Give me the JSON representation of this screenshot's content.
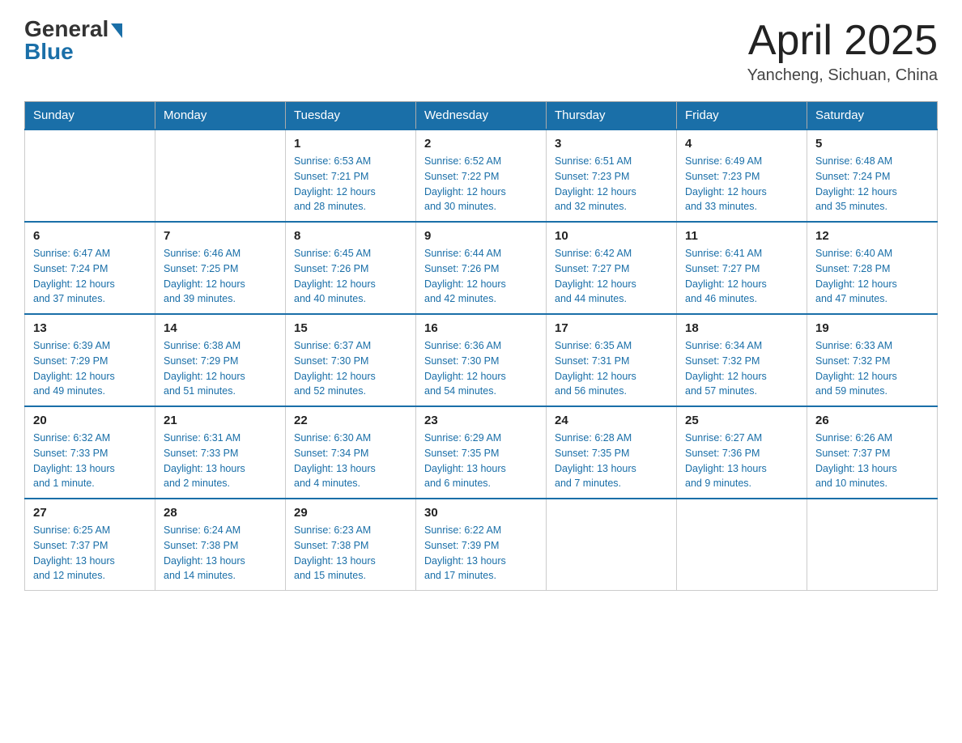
{
  "header": {
    "logo_general": "General",
    "logo_blue": "Blue",
    "title": "April 2025",
    "location": "Yancheng, Sichuan, China"
  },
  "days_of_week": [
    "Sunday",
    "Monday",
    "Tuesday",
    "Wednesday",
    "Thursday",
    "Friday",
    "Saturday"
  ],
  "weeks": [
    [
      {
        "day": "",
        "info": ""
      },
      {
        "day": "",
        "info": ""
      },
      {
        "day": "1",
        "info": "Sunrise: 6:53 AM\nSunset: 7:21 PM\nDaylight: 12 hours\nand 28 minutes."
      },
      {
        "day": "2",
        "info": "Sunrise: 6:52 AM\nSunset: 7:22 PM\nDaylight: 12 hours\nand 30 minutes."
      },
      {
        "day": "3",
        "info": "Sunrise: 6:51 AM\nSunset: 7:23 PM\nDaylight: 12 hours\nand 32 minutes."
      },
      {
        "day": "4",
        "info": "Sunrise: 6:49 AM\nSunset: 7:23 PM\nDaylight: 12 hours\nand 33 minutes."
      },
      {
        "day": "5",
        "info": "Sunrise: 6:48 AM\nSunset: 7:24 PM\nDaylight: 12 hours\nand 35 minutes."
      }
    ],
    [
      {
        "day": "6",
        "info": "Sunrise: 6:47 AM\nSunset: 7:24 PM\nDaylight: 12 hours\nand 37 minutes."
      },
      {
        "day": "7",
        "info": "Sunrise: 6:46 AM\nSunset: 7:25 PM\nDaylight: 12 hours\nand 39 minutes."
      },
      {
        "day": "8",
        "info": "Sunrise: 6:45 AM\nSunset: 7:26 PM\nDaylight: 12 hours\nand 40 minutes."
      },
      {
        "day": "9",
        "info": "Sunrise: 6:44 AM\nSunset: 7:26 PM\nDaylight: 12 hours\nand 42 minutes."
      },
      {
        "day": "10",
        "info": "Sunrise: 6:42 AM\nSunset: 7:27 PM\nDaylight: 12 hours\nand 44 minutes."
      },
      {
        "day": "11",
        "info": "Sunrise: 6:41 AM\nSunset: 7:27 PM\nDaylight: 12 hours\nand 46 minutes."
      },
      {
        "day": "12",
        "info": "Sunrise: 6:40 AM\nSunset: 7:28 PM\nDaylight: 12 hours\nand 47 minutes."
      }
    ],
    [
      {
        "day": "13",
        "info": "Sunrise: 6:39 AM\nSunset: 7:29 PM\nDaylight: 12 hours\nand 49 minutes."
      },
      {
        "day": "14",
        "info": "Sunrise: 6:38 AM\nSunset: 7:29 PM\nDaylight: 12 hours\nand 51 minutes."
      },
      {
        "day": "15",
        "info": "Sunrise: 6:37 AM\nSunset: 7:30 PM\nDaylight: 12 hours\nand 52 minutes."
      },
      {
        "day": "16",
        "info": "Sunrise: 6:36 AM\nSunset: 7:30 PM\nDaylight: 12 hours\nand 54 minutes."
      },
      {
        "day": "17",
        "info": "Sunrise: 6:35 AM\nSunset: 7:31 PM\nDaylight: 12 hours\nand 56 minutes."
      },
      {
        "day": "18",
        "info": "Sunrise: 6:34 AM\nSunset: 7:32 PM\nDaylight: 12 hours\nand 57 minutes."
      },
      {
        "day": "19",
        "info": "Sunrise: 6:33 AM\nSunset: 7:32 PM\nDaylight: 12 hours\nand 59 minutes."
      }
    ],
    [
      {
        "day": "20",
        "info": "Sunrise: 6:32 AM\nSunset: 7:33 PM\nDaylight: 13 hours\nand 1 minute."
      },
      {
        "day": "21",
        "info": "Sunrise: 6:31 AM\nSunset: 7:33 PM\nDaylight: 13 hours\nand 2 minutes."
      },
      {
        "day": "22",
        "info": "Sunrise: 6:30 AM\nSunset: 7:34 PM\nDaylight: 13 hours\nand 4 minutes."
      },
      {
        "day": "23",
        "info": "Sunrise: 6:29 AM\nSunset: 7:35 PM\nDaylight: 13 hours\nand 6 minutes."
      },
      {
        "day": "24",
        "info": "Sunrise: 6:28 AM\nSunset: 7:35 PM\nDaylight: 13 hours\nand 7 minutes."
      },
      {
        "day": "25",
        "info": "Sunrise: 6:27 AM\nSunset: 7:36 PM\nDaylight: 13 hours\nand 9 minutes."
      },
      {
        "day": "26",
        "info": "Sunrise: 6:26 AM\nSunset: 7:37 PM\nDaylight: 13 hours\nand 10 minutes."
      }
    ],
    [
      {
        "day": "27",
        "info": "Sunrise: 6:25 AM\nSunset: 7:37 PM\nDaylight: 13 hours\nand 12 minutes."
      },
      {
        "day": "28",
        "info": "Sunrise: 6:24 AM\nSunset: 7:38 PM\nDaylight: 13 hours\nand 14 minutes."
      },
      {
        "day": "29",
        "info": "Sunrise: 6:23 AM\nSunset: 7:38 PM\nDaylight: 13 hours\nand 15 minutes."
      },
      {
        "day": "30",
        "info": "Sunrise: 6:22 AM\nSunset: 7:39 PM\nDaylight: 13 hours\nand 17 minutes."
      },
      {
        "day": "",
        "info": ""
      },
      {
        "day": "",
        "info": ""
      },
      {
        "day": "",
        "info": ""
      }
    ]
  ]
}
